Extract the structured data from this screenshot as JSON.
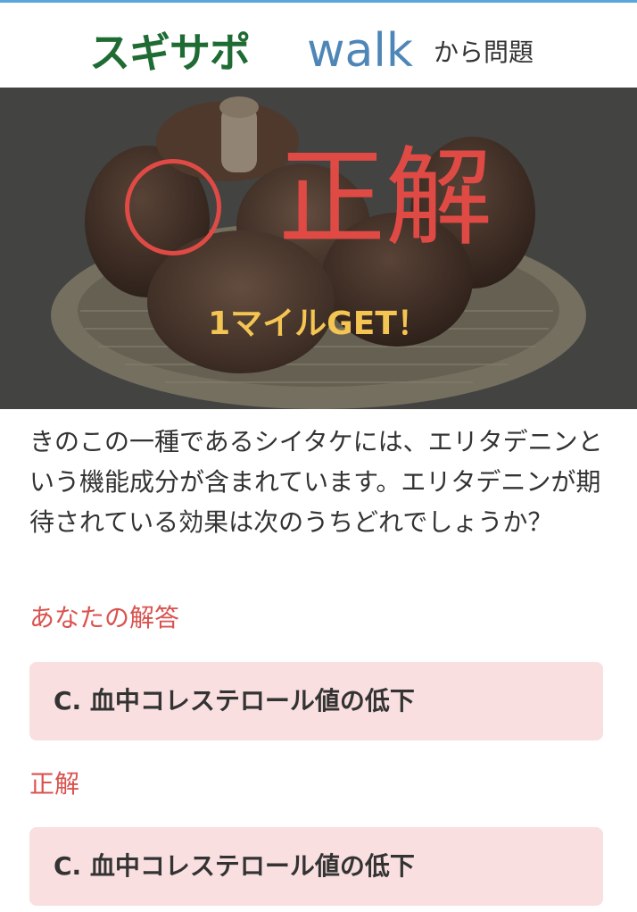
{
  "header": {
    "logo_brand": "スギサポ",
    "logo_app": "walk",
    "suffix": "から問題"
  },
  "hero": {
    "result_label": "正解",
    "reward": "1マイルGET！"
  },
  "question": {
    "text": "きのこの一種であるシイタケには、エリタデニンという機能成分が含まれています。エリタデニンが期待されている効果は次のうちどれでしょうか？"
  },
  "your_answer": {
    "label": "あなたの解答",
    "value": "C. 血中コレステロール値の低下"
  },
  "correct_answer": {
    "label": "正解",
    "value": "C. 血中コレステロール値の低下"
  },
  "colors": {
    "accent_red": "#e04a45",
    "brand_green": "#1f6b34",
    "brand_blue": "#4e86b8",
    "reward_gold": "#f4c552",
    "answer_bg": "#f9dfe0"
  },
  "icons": {
    "correct_mark": "circle-outline-icon"
  }
}
